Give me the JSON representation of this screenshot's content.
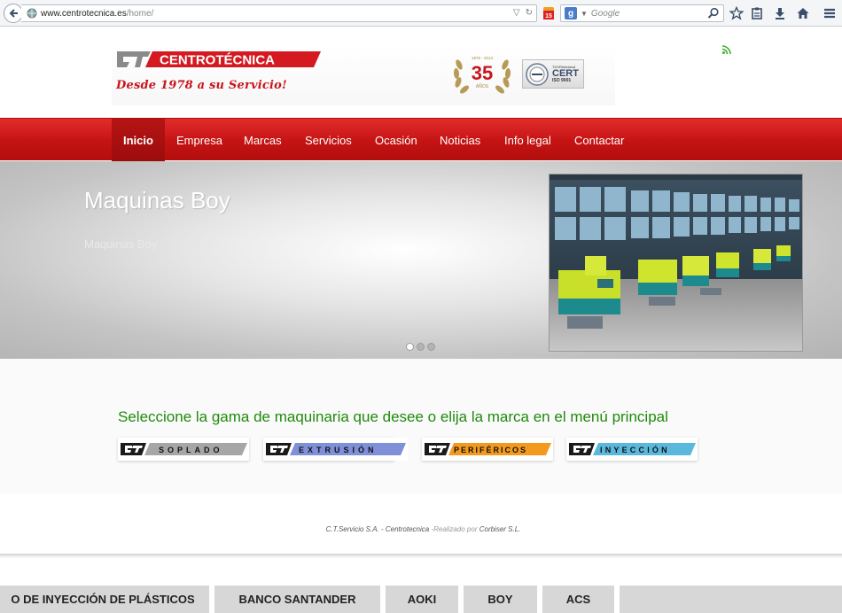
{
  "browser": {
    "url_host": "www.centrotecnica.es",
    "url_path": "/home/",
    "search_placeholder": "Google",
    "extension_badge": "15"
  },
  "header": {
    "logo_text": "CENTROTÉCNICA",
    "slogan": "Desde 1978 a su Servicio!",
    "anniversary_number": "35",
    "anniversary_label": "AÑOS",
    "anniversary_years": "1978 - 2013",
    "cert_small": "TÜVRheinland",
    "cert_big": "CERT",
    "cert_iso": "ISO 9001"
  },
  "nav": {
    "items": [
      "Inicio",
      "Empresa",
      "Marcas",
      "Servicios",
      "Ocasión",
      "Noticias",
      "Info legal",
      "Contactar"
    ],
    "active": "Inicio"
  },
  "slider": {
    "title": "Maquinas Boy",
    "subtitle": "Maquinas Boy",
    "dot_count": 3,
    "active_dot": 0
  },
  "ranges": {
    "title": "Seleccione la gama de maquinaria que desee o elija la marca en el menú principal",
    "buttons": [
      {
        "label": "SOPLADO",
        "color": "#a6a6a6"
      },
      {
        "label": "EXTRUSIÓN",
        "color": "#7f8fd8"
      },
      {
        "label": "PERIFÉRICOS",
        "color": "#f39a1e"
      },
      {
        "label": "INYECCIÓN",
        "color": "#5ab8dc"
      }
    ]
  },
  "footer": {
    "company": "C.T.Servicio S.A. - Centrotecnica",
    "separator": " -Realizado por ",
    "author": "Corbiser S.L."
  },
  "ticker": {
    "items": [
      "O DE INYECCIÓN DE PLÁSTICOS",
      "BANCO SANTANDER",
      "AOKI",
      "BOY",
      "ACS"
    ]
  },
  "colors": {
    "nav_red": "#c41313",
    "brand_red": "#c8151b",
    "section_green": "#1f8a0c"
  }
}
